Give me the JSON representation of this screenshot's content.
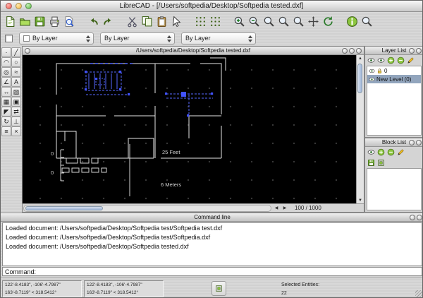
{
  "window": {
    "title": "LibreCAD - [/Users/softpedia/Desktop/Softpedia tested.dxf]"
  },
  "main_toolbar": {
    "items": [
      {
        "name": "new-file-button",
        "icon": "new-file-icon",
        "sym": "#s-page"
      },
      {
        "name": "open-file-button",
        "icon": "open-folder-icon",
        "sym": "#s-folder"
      },
      {
        "name": "save-button",
        "icon": "save-icon",
        "sym": "#s-floppy"
      },
      {
        "name": "print-button",
        "icon": "print-icon",
        "sym": "#s-printer"
      },
      {
        "name": "print-preview-button",
        "icon": "print-preview-icon",
        "sym": "#s-preview"
      },
      {
        "name": "undo-button",
        "icon": "undo-icon",
        "sym": "#s-undo",
        "gap": "1"
      },
      {
        "name": "redo-button",
        "icon": "redo-icon",
        "sym": "#s-redo"
      },
      {
        "name": "cut-button",
        "icon": "cut-icon",
        "sym": "#s-scissors",
        "gap": "1"
      },
      {
        "name": "copy-button",
        "icon": "copy-icon",
        "sym": "#s-copy"
      },
      {
        "name": "paste-button",
        "icon": "paste-icon",
        "sym": "#s-paste"
      },
      {
        "name": "selection-pointer-button",
        "icon": "selection-pointer-icon",
        "sym": "#s-pointer"
      },
      {
        "name": "grid-toggle-button",
        "icon": "grid-icon",
        "sym": "#s-grid",
        "gap": "1"
      },
      {
        "name": "draft-mode-button",
        "icon": "draft-grid-icon",
        "sym": "#s-grid"
      },
      {
        "name": "zoom-in-button",
        "icon": "zoom-in-icon",
        "sym": "#s-mag-plus",
        "gap": "1"
      },
      {
        "name": "zoom-out-button",
        "icon": "zoom-out-icon",
        "sym": "#s-mag-minus"
      },
      {
        "name": "zoom-auto-button",
        "icon": "zoom-auto-icon",
        "sym": "#s-mag"
      },
      {
        "name": "zoom-previous-button",
        "icon": "zoom-previous-icon",
        "sym": "#s-mag"
      },
      {
        "name": "zoom-window-button",
        "icon": "zoom-window-icon",
        "sym": "#s-mag"
      },
      {
        "name": "zoom-pan-button",
        "icon": "zoom-pan-icon",
        "sym": "#s-pan"
      },
      {
        "name": "redraw-button",
        "icon": "redraw-icon",
        "sym": "#s-redraw"
      },
      {
        "name": "info-button",
        "icon": "info-icon",
        "sym": "#s-info",
        "gap": "1"
      },
      {
        "name": "measure-button",
        "icon": "measure-icon",
        "sym": "#s-mag"
      }
    ]
  },
  "pen_toolbar": {
    "color_label": "By Layer",
    "width_label": "By Layer",
    "linetype_label": "By Layer"
  },
  "palette": {
    "tools": [
      {
        "name": "point-tool-button",
        "icon": "point-icon",
        "glyph": "·"
      },
      {
        "name": "line-tool-button",
        "icon": "line-icon",
        "glyph": "╱"
      },
      {
        "name": "arc-tool-button",
        "icon": "arc-icon",
        "glyph": "◠"
      },
      {
        "name": "circle-tool-button",
        "icon": "circle-icon",
        "glyph": "○"
      },
      {
        "name": "ellipse-tool-button",
        "icon": "ellipse-icon",
        "glyph": "◎"
      },
      {
        "name": "spline-tool-button",
        "icon": "spline-icon",
        "glyph": "≈"
      },
      {
        "name": "polyline-tool-button",
        "icon": "polyline-icon",
        "glyph": "∠"
      },
      {
        "name": "text-tool-button",
        "icon": "text-icon",
        "glyph": "A"
      },
      {
        "name": "dimension-tool-button",
        "icon": "dimension-icon",
        "glyph": "↔"
      },
      {
        "name": "hatch-tool-button",
        "icon": "hatch-icon",
        "glyph": "▨"
      },
      {
        "name": "image-tool-button",
        "icon": "image-icon",
        "glyph": "▦"
      },
      {
        "name": "block-tool-button",
        "icon": "block-icon",
        "glyph": "▣"
      },
      {
        "name": "select-tool-button",
        "icon": "select-icon",
        "glyph": "◤"
      },
      {
        "name": "move-tool-button",
        "icon": "move-icon",
        "glyph": "⇄"
      },
      {
        "name": "rotate-tool-button",
        "icon": "rotate-icon",
        "glyph": "↻"
      },
      {
        "name": "trim-tool-button",
        "icon": "trim-icon",
        "glyph": "⊥"
      },
      {
        "name": "measure-tool-button",
        "icon": "measure-icon",
        "glyph": "≡"
      },
      {
        "name": "delete-tool-button",
        "icon": "delete-icon",
        "glyph": "×"
      }
    ]
  },
  "document": {
    "title": "/Users/softpedia/Desktop/Softpedia tested.dxf",
    "zoom_label": "100 / 1000",
    "annotations": {
      "feet": "25 Feet",
      "meters": "6 Meters",
      "zero_top": "0",
      "zero_bottom": "0"
    }
  },
  "layer_panel": {
    "title": "Layer List",
    "tools": [
      {
        "name": "toggle-all-layers-visibility-button",
        "icon": "eye-icon",
        "sym": "#s-eye"
      },
      {
        "name": "toggle-layer-visibility-button",
        "icon": "eye-icon",
        "sym": "#s-eye"
      },
      {
        "name": "add-layer-button",
        "icon": "plus-icon",
        "sym": "#s-plus"
      },
      {
        "name": "remove-layer-button",
        "icon": "minus-icon",
        "sym": "#s-minus"
      },
      {
        "name": "edit-layer-button",
        "icon": "pencil-icon",
        "sym": "#s-pencil"
      }
    ],
    "layers": [
      {
        "name": "0"
      },
      {
        "name": "New Level (0)"
      }
    ]
  },
  "block_panel": {
    "title": "Block List",
    "tools_row1": [
      {
        "name": "toggle-all-blocks-visibility-button",
        "icon": "eye-icon",
        "sym": "#s-eye"
      },
      {
        "name": "add-block-button",
        "icon": "plus-icon",
        "sym": "#s-plus"
      },
      {
        "name": "remove-block-button",
        "icon": "minus-icon",
        "sym": "#s-minus"
      },
      {
        "name": "edit-block-button",
        "icon": "pencil-icon",
        "sym": "#s-pencil"
      }
    ],
    "tools_row2": [
      {
        "name": "save-block-button",
        "icon": "save-icon",
        "sym": "#s-floppy"
      },
      {
        "name": "insert-block-button",
        "icon": "block-icon",
        "sym": "#s-block"
      }
    ]
  },
  "command_panel": {
    "title": "Command line",
    "lines": [
      "Loaded document: /Users/softpedia/Desktop/Softpedia test/Softpedia test.dxf",
      "Loaded document: /Users/softpedia/Desktop/Softpedia test/Softpedia.dxf",
      "Loaded document: /Users/softpedia/Desktop/Softpedia tested.dxf"
    ],
    "prompt_label": "Command:",
    "input_value": ""
  },
  "status_bar": {
    "absolute": {
      "line1": "122'-8.4183\", -106'-4.7987\"",
      "line2": "163'-8.7119\" < 318.5412°"
    },
    "relative": {
      "line1": "122'-8.4183\", -106'-4.7987\"",
      "line2": "163'-8.7119\" < 318.5412°"
    },
    "selected_label": "Selected Entities:",
    "selected_count": "22"
  }
}
